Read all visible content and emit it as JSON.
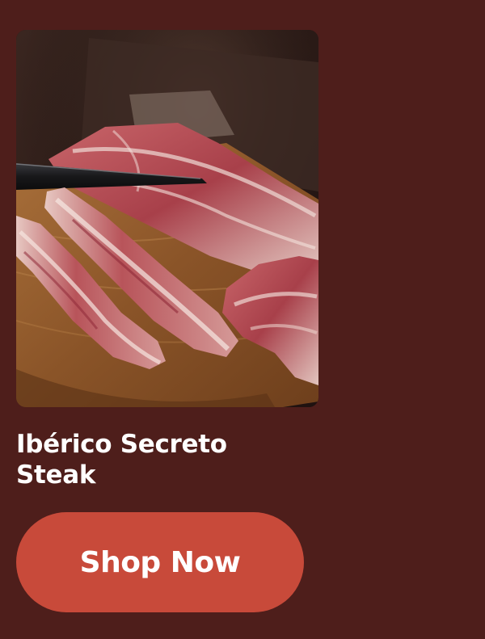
{
  "product": {
    "title_line1": "Ibérico Secreto",
    "title_line2": "Steak",
    "image_alt": "Raw Ibérico secreto steak strips on a wooden cutting board with a knife"
  },
  "cta": {
    "label": "Shop Now"
  },
  "colors": {
    "background": "#4e1e1b",
    "button": "#c84a3a",
    "text": "#ffffff"
  }
}
